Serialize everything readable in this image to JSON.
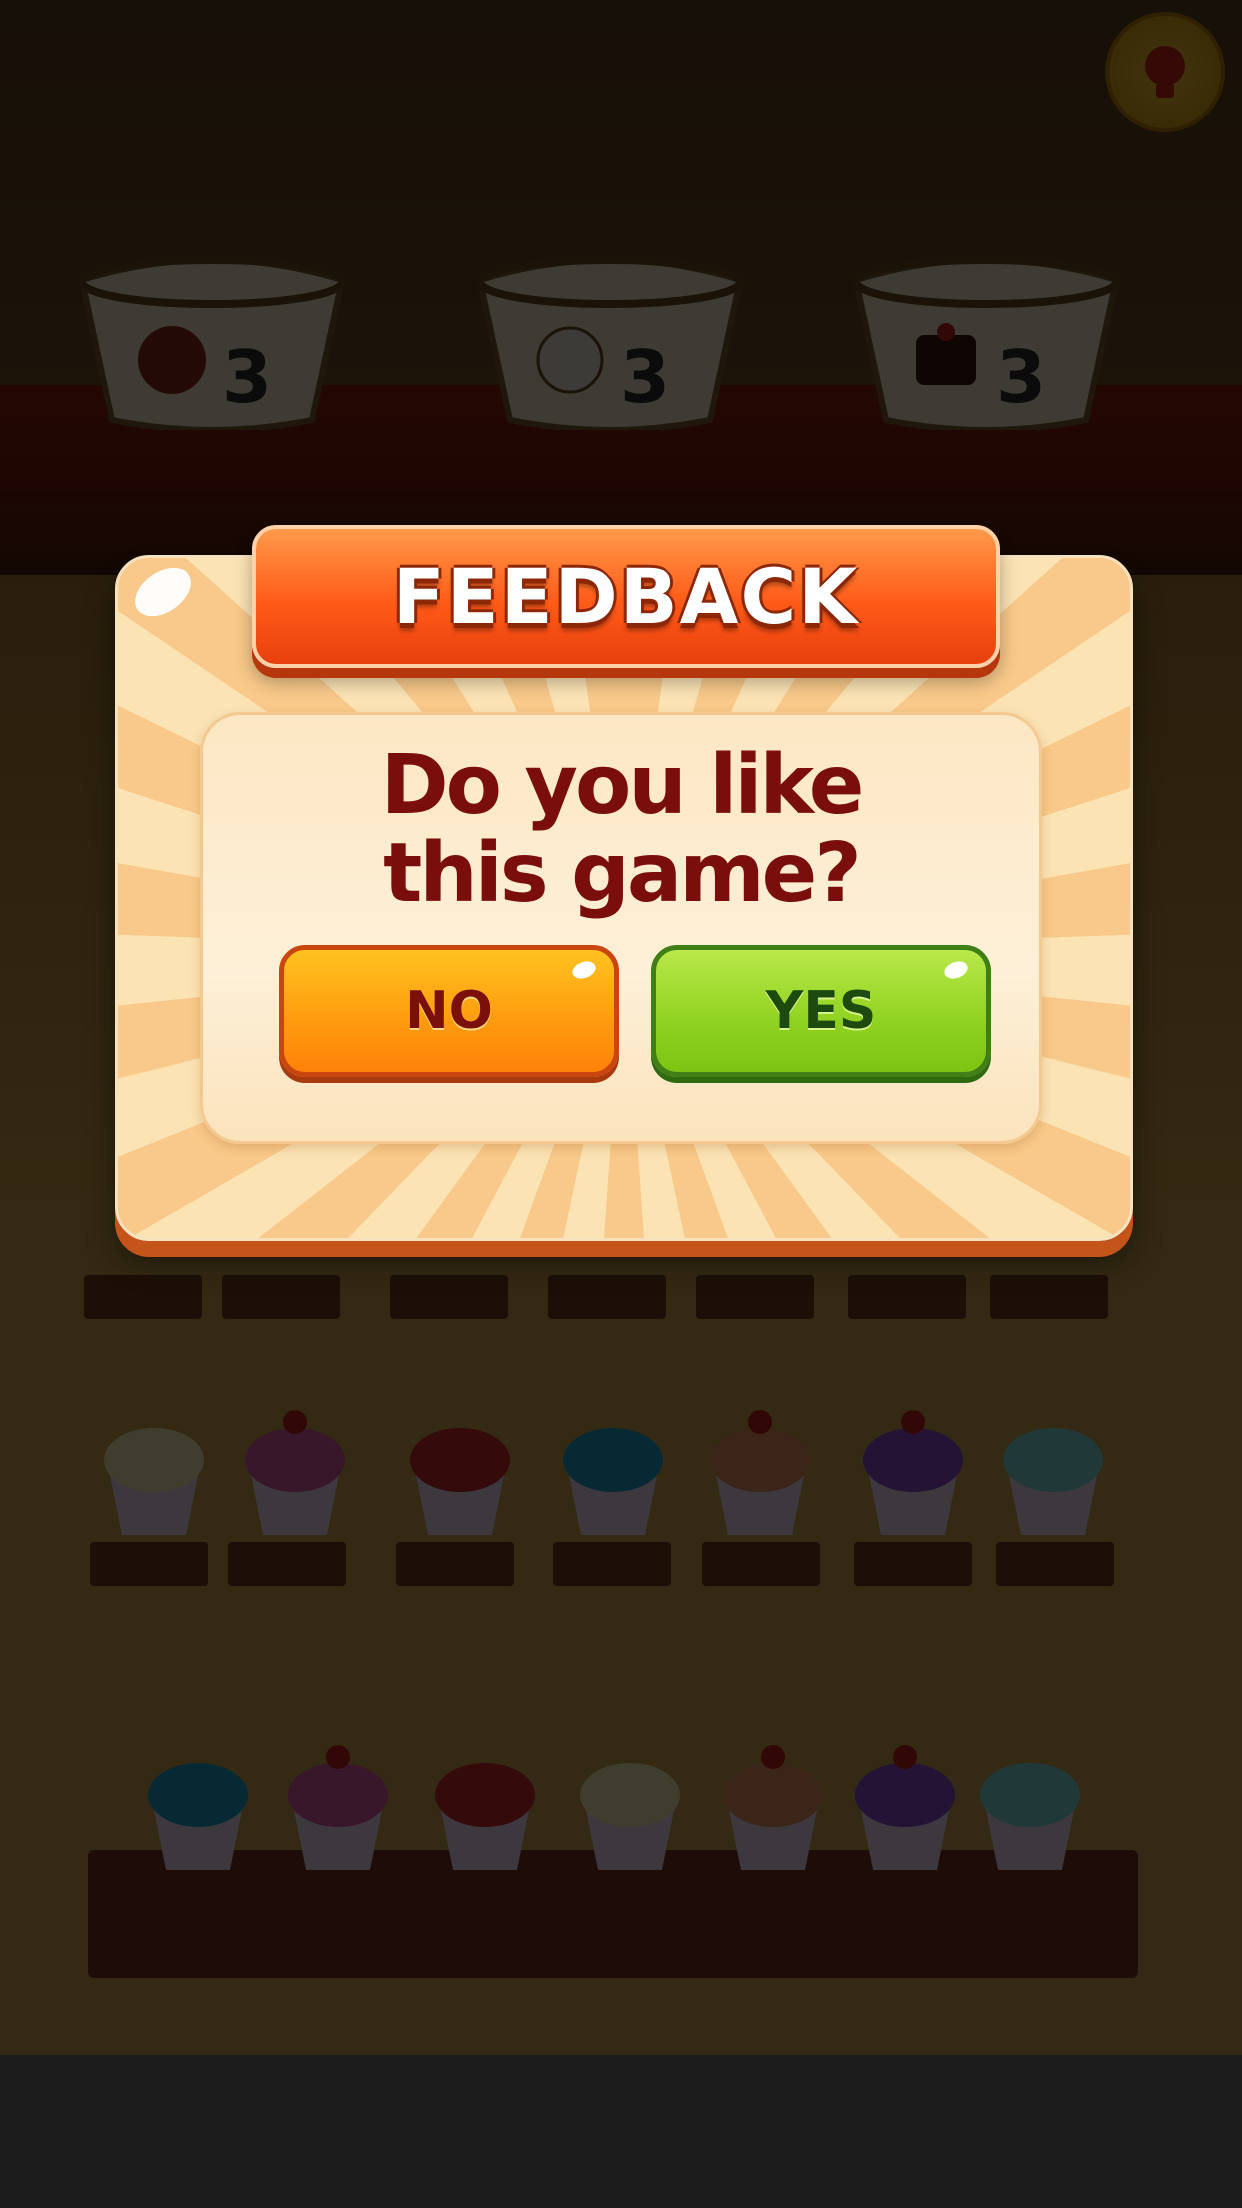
{
  "dialog": {
    "title": "FEEDBACK",
    "question": "Do you like this game?",
    "no_label": "NO",
    "yes_label": "YES"
  },
  "buckets": [
    {
      "item": "strawberry-donut-icon",
      "count": "3"
    },
    {
      "item": "cream-cake-icon",
      "count": "3"
    },
    {
      "item": "chocolate-cake-icon",
      "count": "3"
    }
  ],
  "colors": {
    "banner": "#ff5a18",
    "question_text": "#7a0e0c",
    "no_button": "#ff9a0e",
    "yes_button": "#8fd11f",
    "overlay": "#000000"
  }
}
